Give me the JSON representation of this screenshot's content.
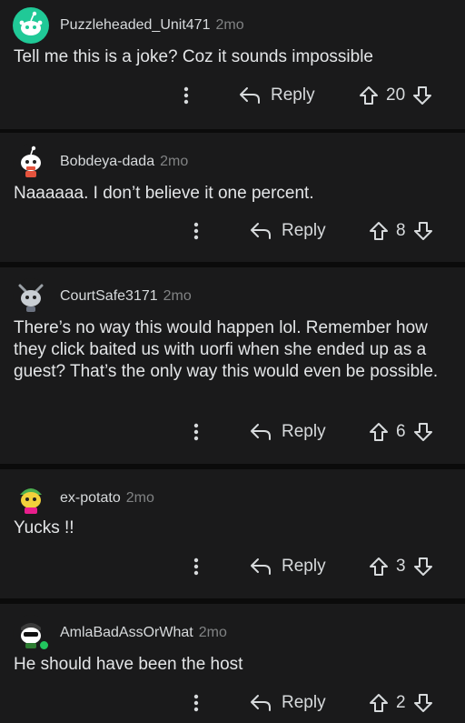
{
  "comments": [
    {
      "username": "Puzzleheaded_Unit471",
      "time": "2mo",
      "body": "Tell me this is a joke? Coz it sounds impossible",
      "reply_label": "Reply",
      "votes": "20",
      "avatar": {
        "bg": "#20c997",
        "accent": "#ffffff"
      }
    },
    {
      "username": "Bobdeya-dada",
      "time": "2mo",
      "body": "Naaaaaa. I don’t believe it one percent.",
      "reply_label": "Reply",
      "votes": "8",
      "avatar": {
        "bg": "#1a1a1b",
        "accent": "#ffffff"
      }
    },
    {
      "username": "CourtSafe3171",
      "time": "2mo",
      "body": "There’s no way this would happen lol. Remember how they click baited us with uorfi when she ended up as a guest? That’s the only way this would even be possible.",
      "reply_label": "Reply",
      "votes": "6",
      "avatar": {
        "bg": "#1a1a1b",
        "accent": "#9aa0a6"
      }
    },
    {
      "username": "ex-potato",
      "time": "2mo",
      "body": "Yucks !!",
      "reply_label": "Reply",
      "votes": "3",
      "avatar": {
        "bg": "#1a1a1b",
        "accent": "#f2d13b"
      }
    },
    {
      "username": "AmlaBadAssOrWhat",
      "time": "2mo",
      "body": "He should have been the host",
      "reply_label": "Reply",
      "votes": "2",
      "avatar": {
        "bg": "#1a1a1b",
        "accent": "#ffffff",
        "online": true
      }
    }
  ]
}
